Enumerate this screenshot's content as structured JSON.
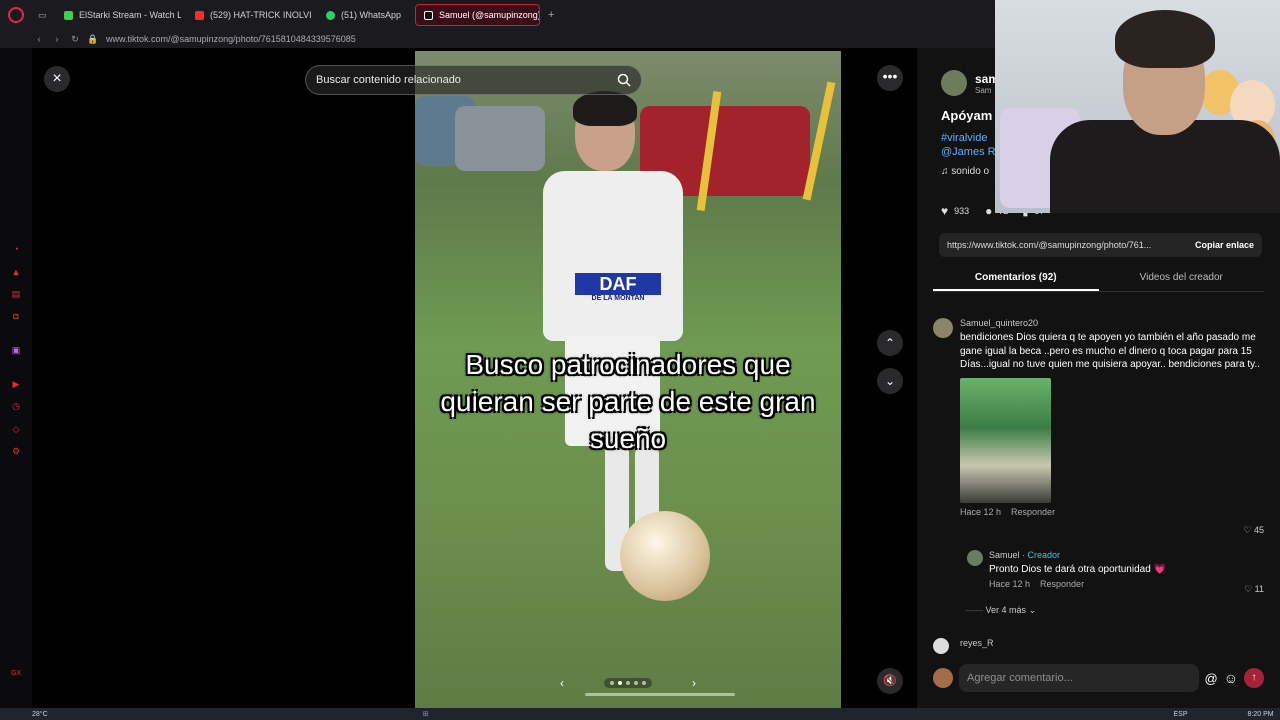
{
  "browser": {
    "tabs": [
      {
        "label": "ElStarki Stream - Watch Li",
        "color": "#3bd14a"
      },
      {
        "label": "(529) HAT-TRICK INOLVID",
        "color": "#ff2a2a"
      },
      {
        "label": "(51) WhatsApp",
        "color": "#25d366"
      },
      {
        "label": "Samuel (@samupinzong) |",
        "color": "#ffffff",
        "active": true
      }
    ],
    "new_tab": "+",
    "url": "www.tiktok.com/@samupinzong/photo/7615810484339576085"
  },
  "viewer": {
    "close_icon": "×",
    "search_placeholder": "Buscar contenido relacionado",
    "more_icon": "•••",
    "overlay_text": "Busco patrocinadores que quieran ser parte de este gran sueño",
    "shirt_brand": "DAF",
    "shirt_sub": "DE LA MONTAÑ",
    "prev_icon": "‹",
    "next_icon": "›",
    "up_icon": "⌃",
    "down_icon": "⌄",
    "mute_icon": "🔇",
    "slides_total": 5,
    "slide_active": 1
  },
  "post": {
    "author_short": "sam",
    "author_sub": "Sam",
    "caption": "Apóyam",
    "tag1": "#viralvide",
    "tag2": "@James R",
    "sound": "sonido o",
    "likes": "933",
    "comments_count_icon": "72",
    "saves": "57",
    "link": "https://www.tiktok.com/@samupinzong/photo/761...",
    "copy_label": "Copiar enlace"
  },
  "tabs": {
    "comments": "Comentarios (92)",
    "creator_videos": "Videos del creador"
  },
  "comments": [
    {
      "user": "Samuel_quintero20",
      "text": "bendiciones Dios quiera q te apoyen yo también el año pasado me gane igual la beca ..pero es mucho el dinero q toca pagar para 15 Días...igual no tuve quien me quisiera apoyar.. bendiciones para ty..",
      "time": "Hace 12 h",
      "reply": "Responder",
      "likes": "45"
    }
  ],
  "reply": {
    "user": "Samuel",
    "badge": "· Creador",
    "text": "Pronto Dios te dará otra oportunidad 💗",
    "time": "Hace 12 h",
    "reply": "Responder",
    "likes": "11"
  },
  "see_more": "Ver 4 más",
  "next_user": "reyes_R",
  "input_placeholder": "Agregar comentario...",
  "at_icon": "@",
  "emoji_icon": "☺",
  "send_icon": "↑",
  "taskbar": {
    "weather": "28°C",
    "lang": "ESP",
    "time": "8:20 PM"
  }
}
